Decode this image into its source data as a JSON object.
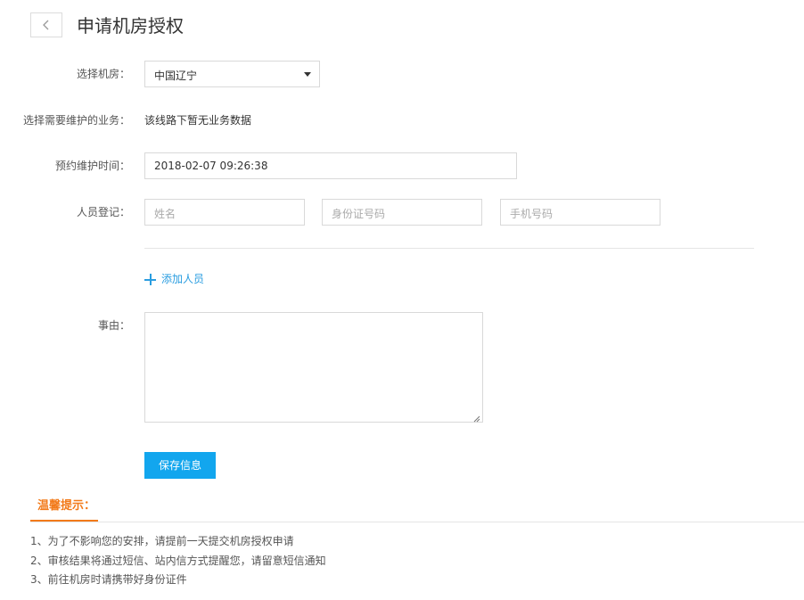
{
  "header": {
    "title": "申请机房授权",
    "back_icon": "chevron-left-icon"
  },
  "form": {
    "room": {
      "label": "选择机房：",
      "value": "中国辽宁"
    },
    "business": {
      "label": "选择需要维护的业务：",
      "value": "该线路下暂无业务数据"
    },
    "maintenance_time": {
      "label": "预约维护时间：",
      "value": "2018-02-07 09:26:38"
    },
    "personnel": {
      "label": "人员登记：",
      "name_placeholder": "姓名",
      "id_placeholder": "身份证号码",
      "phone_placeholder": "手机号码"
    },
    "add_person_label": "添加人员",
    "reason": {
      "label": "事由：",
      "value": ""
    },
    "save_label": "保存信息"
  },
  "tips": {
    "heading": "温馨提示：",
    "items": [
      "1、为了不影响您的安排，请提前一天提交机房授权申请",
      "2、审核结果将通过短信、站内信方式提醒您，请留意短信通知",
      "3、前往机房时请携带好身份证件"
    ]
  },
  "colors": {
    "accent": "#12a6ee",
    "link": "#2a9de0",
    "tips": "#f27a1a"
  }
}
